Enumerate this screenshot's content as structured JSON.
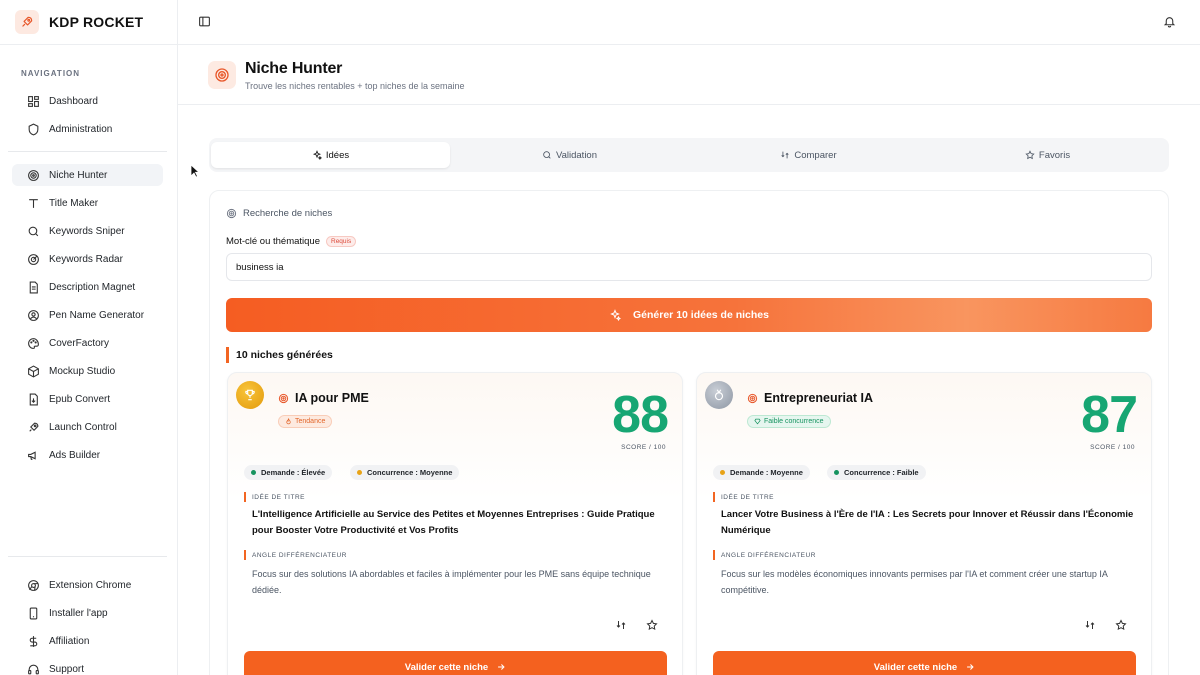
{
  "brand": {
    "name": "KDP ROCKET",
    "icon": "rocket-icon"
  },
  "sidebar": {
    "heading": "NAVIGATION",
    "group1": [
      {
        "label": "Dashboard",
        "icon": "dashboard-icon"
      },
      {
        "label": "Administration",
        "icon": "shield-icon"
      }
    ],
    "group2": [
      {
        "label": "Niche Hunter",
        "icon": "target-icon",
        "active": true
      },
      {
        "label": "Title Maker",
        "icon": "text-icon"
      },
      {
        "label": "Keywords Sniper",
        "icon": "search-icon"
      },
      {
        "label": "Keywords Radar",
        "icon": "radar-icon"
      },
      {
        "label": "Description Magnet",
        "icon": "document-icon"
      },
      {
        "label": "Pen Name Generator",
        "icon": "user-circle-icon"
      },
      {
        "label": "CoverFactory",
        "icon": "palette-icon"
      },
      {
        "label": "Mockup Studio",
        "icon": "box-icon"
      },
      {
        "label": "Epub Convert",
        "icon": "file-convert-icon"
      },
      {
        "label": "Launch Control",
        "icon": "rocket-icon"
      },
      {
        "label": "Ads Builder",
        "icon": "megaphone-icon"
      }
    ],
    "group3": [
      {
        "label": "Extension Chrome",
        "icon": "chrome-icon"
      },
      {
        "label": "Installer l'app",
        "icon": "phone-icon"
      },
      {
        "label": "Affiliation",
        "icon": "dollar-icon"
      },
      {
        "label": "Support",
        "icon": "headset-icon"
      }
    ]
  },
  "header": {
    "title": "Niche Hunter",
    "subtitle": "Trouve les niches rentables + top niches de la semaine"
  },
  "tabs": [
    {
      "label": "Idées",
      "icon": "sparkles-icon",
      "active": true
    },
    {
      "label": "Validation",
      "icon": "search-icon"
    },
    {
      "label": "Comparer",
      "icon": "compare-icon"
    },
    {
      "label": "Favoris",
      "icon": "star-icon"
    }
  ],
  "search": {
    "section_label": "Recherche de niches",
    "field_label": "Mot-clé ou thématique",
    "required_badge": "Requis",
    "value": "business ia",
    "generate_label": "Générer 10 idées de niches"
  },
  "results": {
    "heading": "10 niches générées",
    "cards": [
      {
        "title": "IA pour PME",
        "tag": "Tendance",
        "score": "88",
        "score_label": "SCORE / 100",
        "chips": [
          "Demande : Élevée",
          "Concurrence : Moyenne"
        ],
        "title_idea_label": "IDÉE DE TITRE",
        "title_idea": "L'Intelligence Artificielle au Service des Petites et Moyennes Entreprises : Guide Pratique pour Booster Votre Productivité et Vos Profits",
        "angle_label": "ANGLE DIFFÉRENCIATEUR",
        "angle": "Focus sur des solutions IA abordables et faciles à implémenter pour les PME sans équipe technique dédiée.",
        "validate_label": "Valider cette niche"
      },
      {
        "title": "Entrepreneuriat IA",
        "tag": "Faible concurrence",
        "score": "87",
        "score_label": "SCORE / 100",
        "chips": [
          "Demande : Moyenne",
          "Concurrence : Faible"
        ],
        "title_idea_label": "IDÉE DE TITRE",
        "title_idea": "Lancer Votre Business à l'Ère de l'IA : Les Secrets pour Innover et Réussir dans l'Économie Numérique",
        "angle_label": "ANGLE DIFFÉRENCIATEUR",
        "angle": "Focus sur les modèles économiques innovants permises par l'IA et comment créer une startup IA compétitive.",
        "validate_label": "Valider cette niche"
      }
    ]
  },
  "colors": {
    "accent": "#f4611f",
    "score": "#17a673",
    "demand_high": "#16935f",
    "competition_mid": "#e8a317"
  }
}
